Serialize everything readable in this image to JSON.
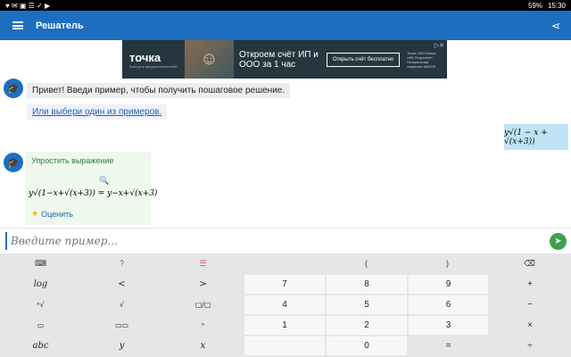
{
  "status": {
    "time": "15:30",
    "battery": "59%"
  },
  "appbar": {
    "title": "Решатель"
  },
  "ad": {
    "brand": "точка",
    "brand_sub": "Банк для предпринимателей",
    "headline": "Откроем счёт ИП и ООО за 1 час",
    "button": "Открыть счёт бесплатно",
    "fine_print": "Точка ПАО Банка «ФК Открытие» Генеральная лицензия №2209"
  },
  "chat": {
    "greeting": "Привет! Введи пример, чтобы получить пошаговое решение.",
    "examples_link": "Или выбери один из примеров.",
    "user_expression": "y√(1 − x + √(x+3))",
    "result": {
      "title": "Упростить выражение",
      "equation": "y√(1−x+√(x+3)) = y−x+√(x+3)",
      "rate": "Оценить"
    }
  },
  "input": {
    "placeholder": "Введите пример..."
  },
  "keyboard": {
    "top": [
      "⌨",
      "?",
      "☰",
      "(",
      ")",
      "⌫"
    ],
    "rows": [
      [
        "log",
        "<",
        ">",
        "7",
        "8",
        "9",
        "+"
      ],
      [
        "ⁿ√",
        "√",
        "▢/▢",
        "4",
        "5",
        "6",
        "−"
      ],
      [
        "▭",
        "▭▭",
        "ⁿ",
        "1",
        "2",
        "3",
        "×"
      ],
      [
        "abc",
        "y",
        "x",
        "",
        "0",
        "=",
        "÷"
      ]
    ]
  }
}
